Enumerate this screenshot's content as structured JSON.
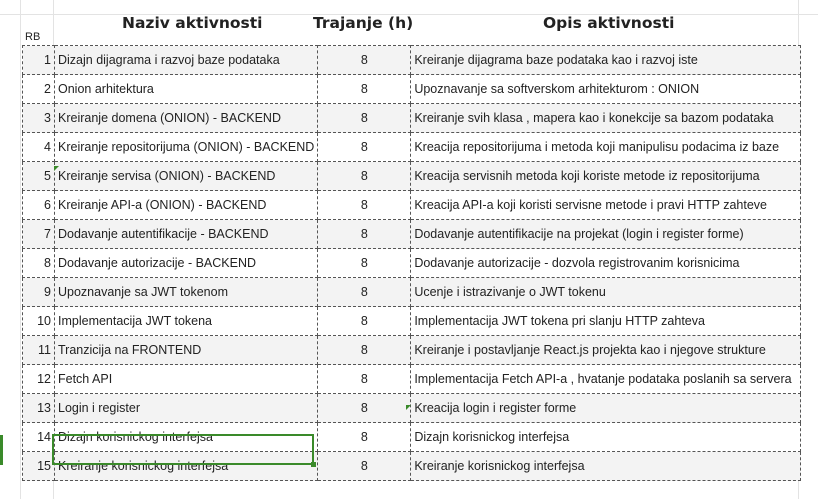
{
  "headers": {
    "name": "Naziv aktivnosti",
    "duration": "Trajanje  (h)",
    "description": "Opis aktivnosti",
    "rb": "RB"
  },
  "colors": {
    "selection": "#3a8a2a",
    "band": "#f3f3f3"
  },
  "rows": [
    {
      "rb": "1",
      "name": "Dizajn dijagrama i razvoj baze podataka",
      "duration": "8",
      "description": "Kreiranje dijagrama baze podataka kao i razvoj iste"
    },
    {
      "rb": "2",
      "name": "Onion arhitektura",
      "duration": "8",
      "description": "Upoznavanje sa softverskom arhitekturom : ONION"
    },
    {
      "rb": "3",
      "name": "Kreiranje domena (ONION) - BACKEND",
      "duration": "8",
      "description": "Kreiranje svih klasa , mapera kao i konekcije sa bazom podataka"
    },
    {
      "rb": "4",
      "name": "Kreiranje repositorijuma (ONION) - BACKEND",
      "duration": "8",
      "description": "Kreacija repositorijuma i metoda koji manipulisu podacima iz baze"
    },
    {
      "rb": "5",
      "name": "Kreiranje servisa (ONION) - BACKEND",
      "duration": "8",
      "description": "Kreacija servisnih metoda koji koriste metode iz repositorijuma"
    },
    {
      "rb": "6",
      "name": "Kreiranje API-a (ONION) - BACKEND",
      "duration": "8",
      "description": "Kreacija API-a koji koristi servisne metode i pravi HTTP zahteve"
    },
    {
      "rb": "7",
      "name": "Dodavanje autentifikacije - BACKEND",
      "duration": "8",
      "description": "Dodavanje autentifikacije na projekat (login i register forme)"
    },
    {
      "rb": "8",
      "name": "Dodavanje autorizacije - BACKEND",
      "duration": "8",
      "description": "Dodavanje autorizacije - dozvola registrovanim korisnicima"
    },
    {
      "rb": "9",
      "name": "Upoznavanje sa JWT tokenom",
      "duration": "8",
      "description": "Ucenje i istrazivanje o JWT tokenu"
    },
    {
      "rb": "10",
      "name": "Implementacija JWT tokena",
      "duration": "8",
      "description": "Implementacija JWT tokena pri slanju HTTP zahteva"
    },
    {
      "rb": "11",
      "name": "Tranzicija na FRONTEND",
      "duration": "8",
      "description": "Kreiranje i postavljanje React.js projekta kao i njegove strukture"
    },
    {
      "rb": "12",
      "name": "Fetch API",
      "duration": "8",
      "description": "Implementacija Fetch API-a , hvatanje podataka poslanih sa servera"
    },
    {
      "rb": "13",
      "name": "Login i register",
      "duration": "8",
      "description": "Kreacija login i register forme"
    },
    {
      "rb": "14",
      "name": "Dizajn korisnickog interfejsa",
      "duration": "8",
      "description": "Dizajn korisnickog interfejsa"
    },
    {
      "rb": "15",
      "name": "Kreiranje korisnickog interfejsa",
      "duration": "8",
      "description": "Kreiranje korisnickog interfejsa"
    }
  ]
}
